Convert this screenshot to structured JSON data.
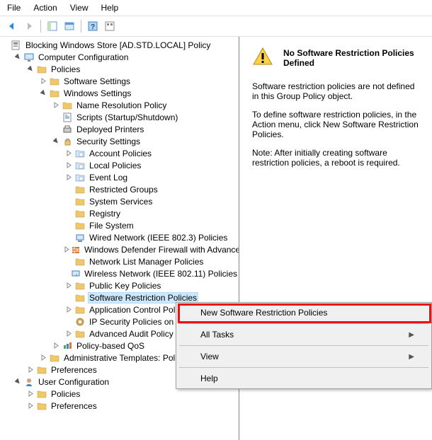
{
  "menu": {
    "m0": "File",
    "m1": "Action",
    "m2": "View",
    "m3": "Help"
  },
  "root": "Blocking Windows Store [AD.STD.LOCAL] Policy",
  "cc": "Computer Configuration",
  "cc_pol": "Policies",
  "cc_pol_sw": "Software Settings",
  "cc_pol_win": "Windows Settings",
  "nrp": "Name Resolution Policy",
  "scripts": "Scripts (Startup/Shutdown)",
  "dep": "Deployed Printers",
  "sec": "Security Settings",
  "sec_items": {
    "s0": "Account Policies",
    "s1": "Local Policies",
    "s2": "Event Log",
    "s3": "Restricted Groups",
    "s4": "System Services",
    "s5": "Registry",
    "s6": "File System",
    "s7": "Wired Network (IEEE 802.3) Policies",
    "s8": "Windows Defender Firewall with Advanced Security",
    "s9": "Network List Manager Policies",
    "s10": "Wireless Network (IEEE 802.11) Policies",
    "s11": "Public Key Policies",
    "s12": "Software Restriction Policies",
    "s13": "Application Control Policies",
    "s14": "IP Security Policies on Active Directory",
    "s15": "Advanced Audit Policy Configuration"
  },
  "qos": "Policy-based QoS",
  "admin": "Administrative Templates: Policy definitions",
  "cc_pref": "Preferences",
  "uc": "User Configuration",
  "uc_pol": "Policies",
  "uc_pref": "Preferences",
  "det_title": "No Software Restriction Policies Defined",
  "det_p1": "Software restriction policies are not defined in this Group Policy object.",
  "det_p2": "To define software restriction policies, in the Action menu, click New Software Restriction Policies.",
  "det_p3": "Note: After initially creating software restriction policies, a reboot is required.",
  "ctx": {
    "c0": "New Software Restriction Policies",
    "c1": "All Tasks",
    "c2": "View",
    "c3": "Help"
  }
}
